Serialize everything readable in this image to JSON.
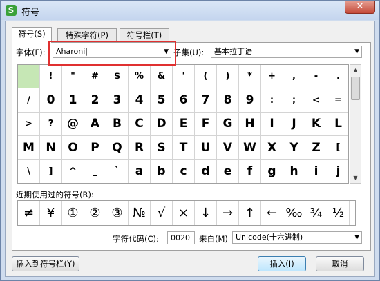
{
  "window": {
    "title": "符号",
    "app_icon_glyph": "S",
    "close_glyph": "✕"
  },
  "tabs": [
    {
      "label": "符号(S)"
    },
    {
      "label": "特殊字符(P)"
    },
    {
      "label": "符号栏(T)"
    }
  ],
  "font": {
    "label": "字体(F):",
    "value": "Aharoni|"
  },
  "subset": {
    "label": "子集(U):",
    "value": "基本拉丁语"
  },
  "symbols": [
    " ",
    "!",
    "\"",
    "#",
    "$",
    "%",
    "&",
    "'",
    "(",
    ")",
    "*",
    "+",
    ",",
    "-",
    ".",
    "/",
    "0",
    "1",
    "2",
    "3",
    "4",
    "5",
    "6",
    "7",
    "8",
    "9",
    ":",
    ";",
    "<",
    "=",
    ">",
    "?",
    "@",
    "A",
    "B",
    "C",
    "D",
    "E",
    "F",
    "G",
    "H",
    "I",
    "J",
    "K",
    "L",
    "M",
    "N",
    "O",
    "P",
    "Q",
    "R",
    "S",
    "T",
    "U",
    "V",
    "W",
    "X",
    "Y",
    "Z",
    "[",
    "\\",
    "]",
    "^",
    "_",
    "`",
    "a",
    "b",
    "c",
    "d",
    "e",
    "f",
    "g",
    "h",
    "i",
    "j"
  ],
  "recent": {
    "label": "近期使用过的符号(R):",
    "items": [
      "≠",
      "¥",
      "①",
      "②",
      "③",
      "№",
      "√",
      "×",
      "↓",
      "→",
      "↑",
      "←",
      "‰",
      "¾",
      "½"
    ]
  },
  "char_code": {
    "label": "字符代码(C):",
    "value": "0020",
    "from_label": "来自(M)",
    "from_value": "Unicode(十六进制)"
  },
  "buttons": {
    "insert_to_bar": "插入到符号栏(Y)",
    "insert": "插入(I)",
    "cancel": "取消"
  },
  "colors": {
    "selected_cell": "#c6e7b5",
    "highlight_border": "#e03030"
  }
}
